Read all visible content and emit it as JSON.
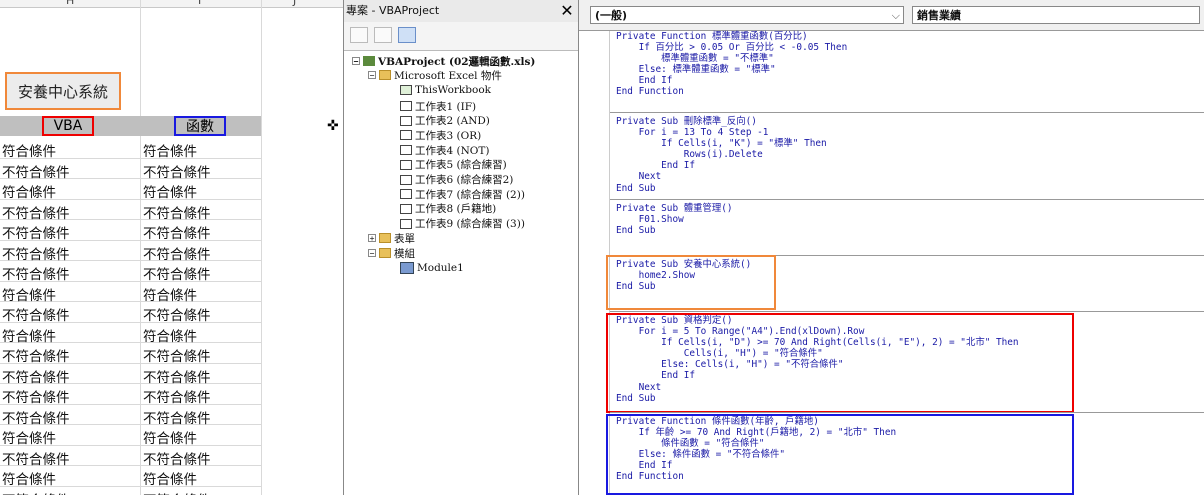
{
  "excel": {
    "col_headers": [
      "H",
      "I",
      "J"
    ],
    "button_label": "安養中心系統",
    "header_vba": "VBA",
    "header_fn": "函數",
    "rows": [
      [
        "符合條件",
        "符合條件"
      ],
      [
        "不符合條件",
        "不符合條件"
      ],
      [
        "符合條件",
        "符合條件"
      ],
      [
        "不符合條件",
        "不符合條件"
      ],
      [
        "不符合條件",
        "不符合條件"
      ],
      [
        "不符合條件",
        "不符合條件"
      ],
      [
        "不符合條件",
        "不符合條件"
      ],
      [
        "符合條件",
        "符合條件"
      ],
      [
        "不符合條件",
        "不符合條件"
      ],
      [
        "符合條件",
        "符合條件"
      ],
      [
        "不符合條件",
        "不符合條件"
      ],
      [
        "不符合條件",
        "不符合條件"
      ],
      [
        "不符合條件",
        "不符合條件"
      ],
      [
        "不符合條件",
        "不符合條件"
      ],
      [
        "符合條件",
        "符合條件"
      ],
      [
        "不符合條件",
        "不符合條件"
      ],
      [
        "符合條件",
        "符合條件"
      ],
      [
        "不符合條件",
        "不符合條件"
      ]
    ]
  },
  "project": {
    "title": "專案 - VBAProject",
    "close": "✕",
    "root": "VBAProject (02邏輯函數.xls)",
    "excel_objects": "Microsoft Excel 物件",
    "this_workbook": "ThisWorkbook",
    "sheets": [
      "工作表1 (IF)",
      "工作表2 (AND)",
      "工作表3 (OR)",
      "工作表4 (NOT)",
      "工作表5 (綜合練習)",
      "工作表6 (綜合練習2)",
      "工作表7 (綜合練習 (2))",
      "工作表8 (戶籍地)",
      "工作表9 (綜合練習 (3))"
    ],
    "forms": "表單",
    "modules": "模組",
    "module1": "Module1"
  },
  "code": {
    "object_combo": "(一般)",
    "proc_combo": "銷售業績",
    "procs": [
      {
        "lines": [
          "Private Function 標準體重函數(百分比)",
          "    If 百分比 > 0.05 Or 百分比 < -0.05 Then",
          "        標準體重函數 = \"不標準\"",
          "    Else: 標準體重函數 = \"標準\"",
          "    End If",
          "",
          "End Function"
        ]
      },
      {
        "lines": [
          "Private Sub 刪除標準_反向()",
          "    For i = 13 To 4 Step -1",
          "        If Cells(i, \"K\") = \"標準\" Then",
          "            Rows(i).Delete",
          "        End If",
          "    Next",
          "End Sub"
        ]
      },
      {
        "lines": [
          "Private Sub 體重管理()",
          "    F01.Show",
          "",
          "End Sub"
        ]
      },
      {
        "lines": [
          "Private Sub 安養中心系統()",
          "    home2.Show",
          "",
          "End Sub"
        ]
      },
      {
        "lines": [
          "Private Sub 資格判定()",
          "    For i = 5 To Range(\"A4\").End(xlDown).Row",
          "        If Cells(i, \"D\") >= 70 And Right(Cells(i, \"E\"), 2) = \"北市\" Then",
          "            Cells(i, \"H\") = \"符合條件\"",
          "        Else: Cells(i, \"H\") = \"不符合條件\"",
          "        End If",
          "    Next",
          "End Sub"
        ]
      },
      {
        "lines": [
          "Private Function 條件函數(年齡, 戶籍地)",
          "    If 年齡 >= 70 And Right(戶籍地, 2) = \"北市\" Then",
          "        條件函數 = \"符合條件\"",
          "    Else: 條件函數 = \"不符合條件\"",
          "    End If",
          "End Function"
        ]
      }
    ]
  }
}
